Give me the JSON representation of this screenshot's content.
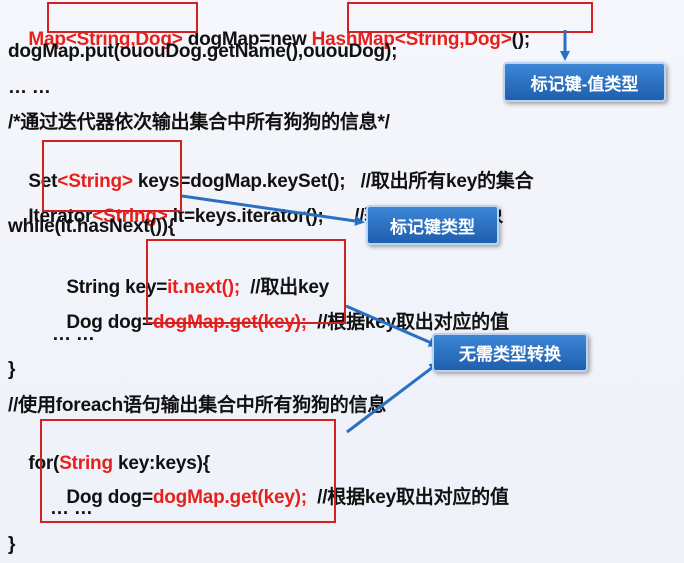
{
  "code": {
    "line1": {
      "p1": "Map",
      "p2": "<String,Dog>",
      "p3": " dogMap=new ",
      "p4": "HashMap<String,Dog>",
      "p5": "();"
    },
    "line2": "dogMap.put(ououDog.getName(),ououDog);",
    "line3": "… …",
    "line4": "/*通过迭代器依次输出集合中所有狗狗的信息*/",
    "line5": {
      "p1": "Set",
      "p2": "<String>",
      "p3": " keys=dogMap.keySet();   //取出所有key的集合"
    },
    "line6": {
      "p1": "Iterator",
      "p2": "<String>",
      "p3": " it=keys.iterator();      //获取Iterator对象"
    },
    "line7": "while(it.hasNext()){",
    "line8": {
      "p1": "String key=",
      "p2": "it.next();",
      "p3": "  //取出key"
    },
    "line9": {
      "p1": "Dog dog=",
      "p2": "dogMap.get(key);",
      "p3": "  //根据key取出对应的值"
    },
    "line10": "… …",
    "line11": "}",
    "line12": "//使用foreach语句输出集合中所有狗狗的信息",
    "line13": {
      "p1": "for(",
      "p2": "String",
      "p3": " key:keys){"
    },
    "line14": {
      "p1": "Dog dog=",
      "p2": "dogMap.get(key);",
      "p3": "  //根据key取出对应的值"
    },
    "line15": "… …",
    "line16": "}"
  },
  "callouts": {
    "key_value_type": "标记键-值类型",
    "key_type": "标记键类型",
    "no_cast": "无需类型转换"
  },
  "colors": {
    "highlight_text": "#e8201c",
    "box_border": "#d42020",
    "callout_bg": "#2a6fc0",
    "arrow": "#2a6fc0"
  }
}
